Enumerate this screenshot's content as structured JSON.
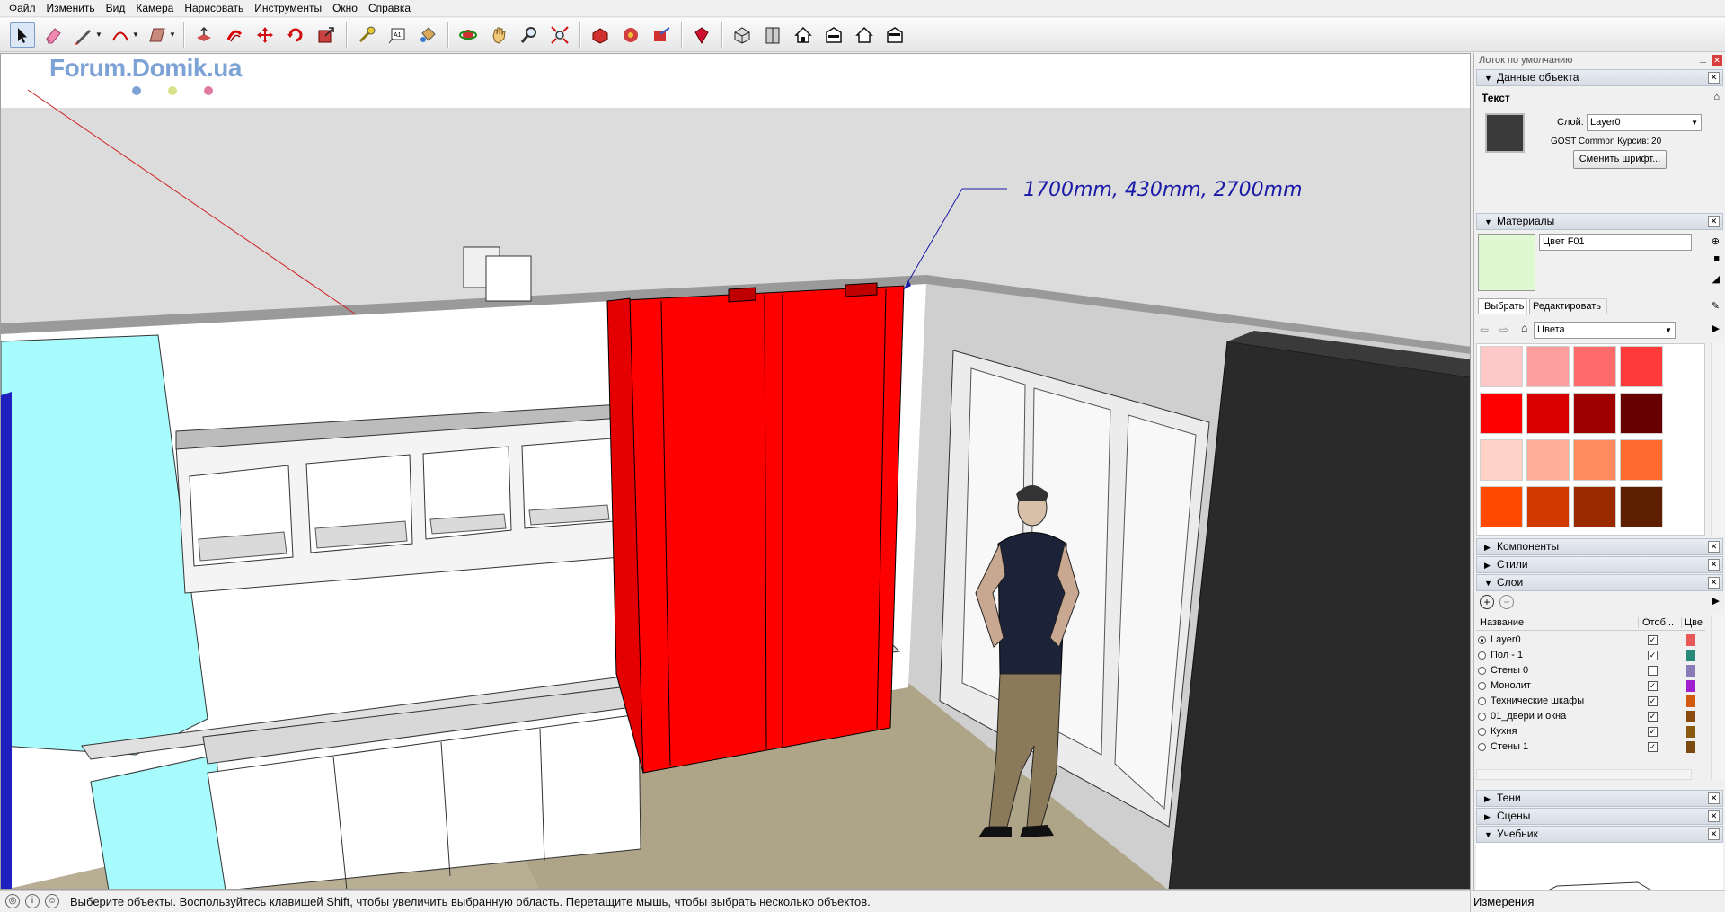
{
  "menu": [
    "Файл",
    "Изменить",
    "Вид",
    "Камера",
    "Нарисовать",
    "Инструменты",
    "Окно",
    "Справка"
  ],
  "toolbar_icons": [
    "select-arrow-icon",
    "eraser-icon",
    "pencil-line-icon",
    "arc-icon",
    "rectangle-icon",
    "push-pull-icon",
    "offset-icon",
    "move-icon",
    "rotate-icon",
    "scale-icon",
    "tape-measure-icon",
    "text-tool-icon",
    "paint-bucket-icon",
    "orbit-icon",
    "pan-icon",
    "zoom-icon",
    "zoom-extents-icon",
    "warehouse-icon",
    "components-icon",
    "share-model-icon",
    "extension-warehouse-icon",
    "iso-view-icon",
    "top-view-icon",
    "front-view-icon",
    "right-view-icon",
    "back-view-icon",
    "left-view-icon"
  ],
  "viewport": {
    "watermark": "Forum.Domik.ua",
    "dimension_label": "1700mm, 430mm, 2700mm"
  },
  "tray": {
    "title": "Лоток по умолчанию",
    "entity_info": {
      "header": "Данные объекта",
      "type": "Текст",
      "layer_label": "Слой:",
      "layer_value": "Layer0",
      "font_info": "GOST Common  Курсив: 20",
      "change_font_button": "Сменить шрифт..."
    },
    "materials": {
      "header": "Материалы",
      "material_name": "Цвет F01",
      "current_color": "#dff8d2",
      "tab_select": "Выбрать",
      "tab_edit": "Редактировать",
      "collection": "Цвета",
      "swatches": [
        "#ffc8c8",
        "#ff9e9e",
        "#ff6a6a",
        "#ff3a3a",
        "#ff0000",
        "#d80000",
        "#9e0000",
        "#660000",
        "#ffd2c8",
        "#ffae98",
        "#ff8a5e",
        "#ff6a2e",
        "#ff4a00",
        "#d03a00",
        "#9a2a00",
        "#5e1e00"
      ]
    },
    "components_header": "Компоненты",
    "styles_header": "Стили",
    "layers": {
      "header": "Слои",
      "col_name": "Название",
      "col_visible": "Отоб...",
      "col_color": "Цве",
      "rows": [
        {
          "name": "Layer0",
          "active": true,
          "visible": true,
          "color": "#e85a5a"
        },
        {
          "name": "Пол - 1",
          "active": false,
          "visible": true,
          "color": "#2a8a7a"
        },
        {
          "name": "Стены 0",
          "active": false,
          "visible": false,
          "color": "#8a7ab8"
        },
        {
          "name": "Монолит",
          "active": false,
          "visible": true,
          "color": "#a020d0"
        },
        {
          "name": "Технические шкафы",
          "active": false,
          "visible": true,
          "color": "#d05a10"
        },
        {
          "name": "01_двери и окна",
          "active": false,
          "visible": true,
          "color": "#8a4a10"
        },
        {
          "name": "Кухня",
          "active": false,
          "visible": true,
          "color": "#8a5a10"
        },
        {
          "name": "Стены 1",
          "active": false,
          "visible": true,
          "color": "#7a4a10"
        }
      ]
    },
    "shadows_header": "Тени",
    "scenes_header": "Сцены",
    "instructor_header": "Учебник"
  },
  "status": {
    "text": "Выберите объекты. Воспользуйтесь клавишей Shift, чтобы увеличить выбранную область. Перетащите мышь, чтобы выбрать несколько объектов.",
    "measurements_label": "Измерения"
  }
}
